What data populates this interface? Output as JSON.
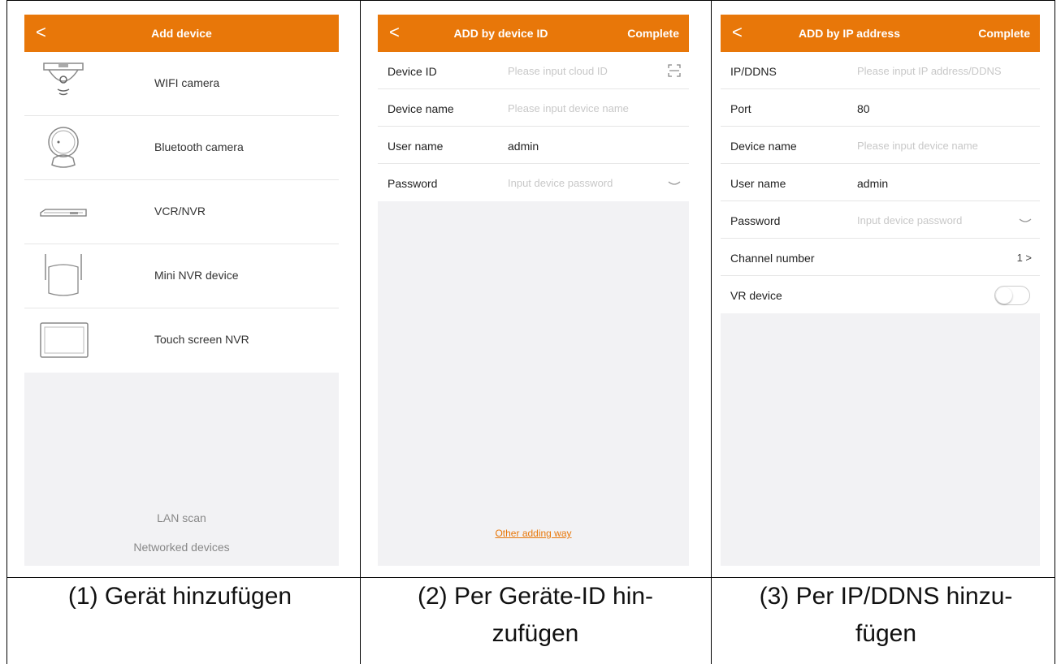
{
  "panel1": {
    "title": "Add device",
    "back": "<",
    "items": [
      {
        "label": "WIFI camera",
        "icon": "wifi-camera-icon"
      },
      {
        "label": "Bluetooth camera",
        "icon": "bluetooth-camera-icon"
      },
      {
        "label": "VCR/NVR",
        "icon": "nvr-recorder-icon"
      },
      {
        "label": "Mini NVR device",
        "icon": "mini-nvr-icon"
      },
      {
        "label": "Touch screen NVR",
        "icon": "touch-screen-nvr-icon"
      }
    ],
    "lan_scan": "LAN scan",
    "networked": "Networked devices"
  },
  "panel2": {
    "title": "ADD by device ID",
    "back": "<",
    "action": "Complete",
    "rows": [
      {
        "key": "Device ID",
        "placeholder": "Please input cloud ID",
        "value": ""
      },
      {
        "key": "Device name",
        "placeholder": "Please input device name",
        "value": ""
      },
      {
        "key": "User name",
        "placeholder": "",
        "value": "admin"
      },
      {
        "key": "Password",
        "placeholder": "Input device password",
        "value": ""
      }
    ],
    "other_link": "Other adding way"
  },
  "panel3": {
    "title": "ADD by IP address",
    "back": "<",
    "action": "Complete",
    "rows": [
      {
        "key": "IP/DDNS",
        "placeholder": "Please input IP address/DDNS",
        "value": ""
      },
      {
        "key": "Port",
        "placeholder": "",
        "value": "80"
      },
      {
        "key": "Device name",
        "placeholder": "Please input device name",
        "value": ""
      },
      {
        "key": "User name",
        "placeholder": "",
        "value": "admin"
      },
      {
        "key": "Password",
        "placeholder": "Input device password",
        "value": ""
      },
      {
        "key": "Channel number",
        "placeholder": "",
        "value": "1 >"
      },
      {
        "key": "VR device",
        "placeholder": "",
        "value": ""
      }
    ]
  },
  "captions": {
    "c1": "(1) Gerät hinzufügen",
    "c2a": "(2) Per Geräte-ID hin-",
    "c2b": "zufügen",
    "c3a": "(3) Per IP/DDNS hinzu-",
    "c3b": "fügen"
  },
  "colors": {
    "accent": "#e87709",
    "background": "#f2f2f4"
  }
}
